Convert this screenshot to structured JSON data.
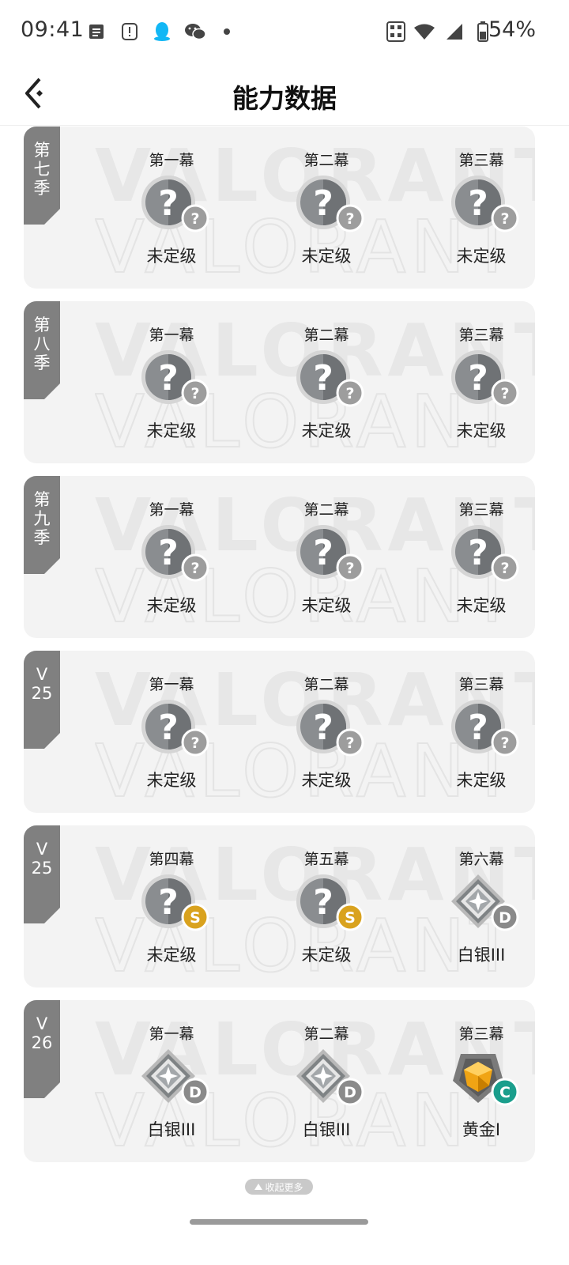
{
  "status_bar": {
    "time": "09:41",
    "battery": "54%",
    "icons": [
      "notes-icon",
      "alert-icon",
      "qq-icon",
      "wechat-icon",
      "dot-icon",
      "nfc-icon",
      "wifi-icon",
      "signal-icon",
      "battery-icon"
    ]
  },
  "header": {
    "title": "能力数据",
    "back_icon": "back-arrow-icon"
  },
  "seasons": [
    {
      "tag": [
        "第",
        "七",
        "季"
      ],
      "acts": [
        {
          "name": "第一幕",
          "rank": "未定级",
          "badge": "unranked",
          "tier": "?"
        },
        {
          "name": "第二幕",
          "rank": "未定级",
          "badge": "unranked",
          "tier": "?"
        },
        {
          "name": "第三幕",
          "rank": "未定级",
          "badge": "unranked",
          "tier": "?"
        }
      ]
    },
    {
      "tag": [
        "第",
        "八",
        "季"
      ],
      "acts": [
        {
          "name": "第一幕",
          "rank": "未定级",
          "badge": "unranked",
          "tier": "?"
        },
        {
          "name": "第二幕",
          "rank": "未定级",
          "badge": "unranked",
          "tier": "?"
        },
        {
          "name": "第三幕",
          "rank": "未定级",
          "badge": "unranked",
          "tier": "?"
        }
      ]
    },
    {
      "tag": [
        "第",
        "九",
        "季"
      ],
      "acts": [
        {
          "name": "第一幕",
          "rank": "未定级",
          "badge": "unranked",
          "tier": "?"
        },
        {
          "name": "第二幕",
          "rank": "未定级",
          "badge": "unranked",
          "tier": "?"
        },
        {
          "name": "第三幕",
          "rank": "未定级",
          "badge": "unranked",
          "tier": "?"
        }
      ]
    },
    {
      "tag": [
        "V",
        "25"
      ],
      "acts": [
        {
          "name": "第一幕",
          "rank": "未定级",
          "badge": "unranked",
          "tier": "?"
        },
        {
          "name": "第二幕",
          "rank": "未定级",
          "badge": "unranked",
          "tier": "?"
        },
        {
          "name": "第三幕",
          "rank": "未定级",
          "badge": "unranked",
          "tier": "?"
        }
      ]
    },
    {
      "tag": [
        "V",
        "25"
      ],
      "acts": [
        {
          "name": "第四幕",
          "rank": "未定级",
          "badge": "unranked",
          "tier": "S"
        },
        {
          "name": "第五幕",
          "rank": "未定级",
          "badge": "unranked",
          "tier": "S"
        },
        {
          "name": "第六幕",
          "rank": "白银III",
          "badge": "silver",
          "tier": "D"
        }
      ]
    },
    {
      "tag": [
        "V",
        "26"
      ],
      "acts": [
        {
          "name": "第一幕",
          "rank": "白银III",
          "badge": "silver",
          "tier": "D"
        },
        {
          "name": "第二幕",
          "rank": "白银III",
          "badge": "silver",
          "tier": "D"
        },
        {
          "name": "第三幕",
          "rank": "黄金I",
          "badge": "gold",
          "tier": "C"
        }
      ]
    }
  ],
  "watermark": "VALORANT",
  "collapse_label": "收起更多",
  "colors": {
    "tag": "#808080",
    "card_bg": "#f3f3f3",
    "tier_s": "#d9a21e",
    "tier_d": "#8a8a8a",
    "tier_c": "#1a9e8c",
    "tier_unknown": "#9d9d9d"
  }
}
